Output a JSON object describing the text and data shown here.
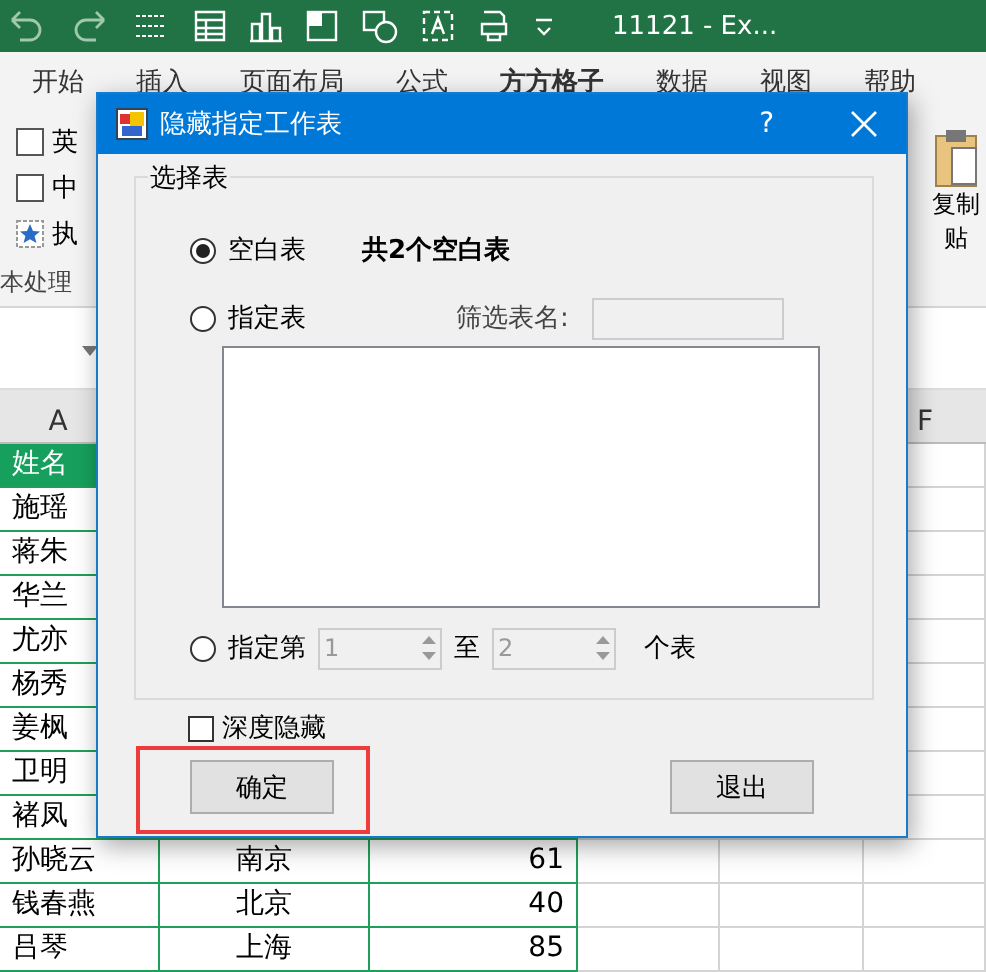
{
  "app_window": {
    "title": "11121 - Ex..."
  },
  "ribbon_tabs": [
    {
      "label": "开始",
      "selected": false
    },
    {
      "label": "插入",
      "selected": false
    },
    {
      "label": "页面布局",
      "selected": false
    },
    {
      "label": "公式",
      "selected": false
    },
    {
      "label": "方方格子",
      "selected": true
    },
    {
      "label": "数据",
      "selected": false
    },
    {
      "label": "视图",
      "selected": false
    },
    {
      "label": "帮助",
      "selected": false
    }
  ],
  "ribbon_options": [
    {
      "kind": "checkbox",
      "label": "英",
      "checked": false
    },
    {
      "kind": "checkbox",
      "label": "中",
      "checked": false
    },
    {
      "kind": "command",
      "label": "执"
    }
  ],
  "ribbon_group_label": "本处理",
  "paste_labels": [
    "复制",
    "贴"
  ],
  "column_headers": {
    "left": "A",
    "right": "F"
  },
  "sheet_rows": [
    {
      "header": true,
      "cells": [
        "姓名",
        "",
        ""
      ]
    },
    {
      "header": false,
      "cells": [
        "施瑶",
        "",
        ""
      ]
    },
    {
      "header": false,
      "cells": [
        "蒋朱",
        "",
        ""
      ]
    },
    {
      "header": false,
      "cells": [
        "华兰",
        "",
        ""
      ]
    },
    {
      "header": false,
      "cells": [
        "尤亦",
        "",
        ""
      ]
    },
    {
      "header": false,
      "cells": [
        "杨秀",
        "",
        ""
      ]
    },
    {
      "header": false,
      "cells": [
        "姜枫",
        "",
        ""
      ]
    },
    {
      "header": false,
      "cells": [
        "卫明",
        "",
        ""
      ]
    },
    {
      "header": false,
      "cells": [
        "褚凤",
        "",
        ""
      ]
    },
    {
      "header": false,
      "cells": [
        "孙晓云",
        "南京",
        "61"
      ]
    },
    {
      "header": false,
      "cells": [
        "钱春燕",
        "北京",
        "40"
      ]
    },
    {
      "header": false,
      "cells": [
        "吕琴",
        "上海",
        "85"
      ]
    }
  ],
  "dialog": {
    "title": "隐藏指定工作表",
    "help": "?",
    "group_title": "选择表",
    "mode_options": [
      {
        "label": "空白表",
        "selected": true,
        "note": "共2个空白表"
      },
      {
        "label": "指定表",
        "selected": false,
        "filter_label": "筛选表名:",
        "filter_disabled": true
      },
      {
        "label": "指定第",
        "selected": false,
        "from": "1",
        "to_label": "至",
        "to": "2",
        "suffix": "个表",
        "disabled": true
      }
    ],
    "deep_hide": {
      "label": "深度隐藏",
      "checked": false
    },
    "buttons": [
      {
        "label": "确定",
        "highlighted": true
      },
      {
        "label": "退出",
        "highlighted": false
      }
    ]
  }
}
